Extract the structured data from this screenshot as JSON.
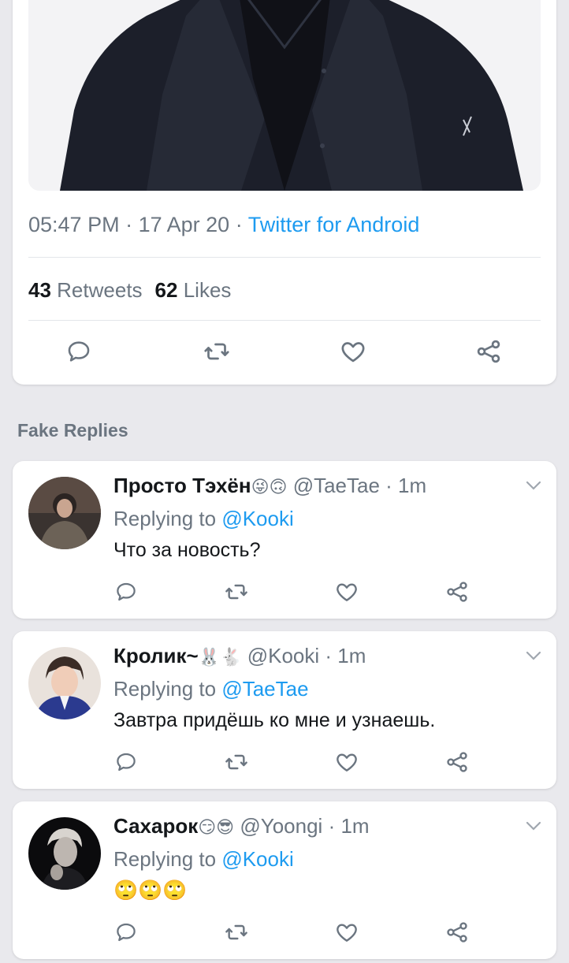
{
  "tweet": {
    "time": "05:47 PM",
    "date": "17 Apr 20",
    "sep": "·",
    "source": "Twitter for Android",
    "retweets_count": "43",
    "retweets_label": "Retweets",
    "likes_count": "62",
    "likes_label": "Likes",
    "actions": [
      "reply-icon",
      "retweet-icon",
      "like-icon",
      "share-icon"
    ]
  },
  "section": {
    "title": "Fake Replies"
  },
  "replies": [
    {
      "name": "Просто Тэхён",
      "emoji": "😜🙃",
      "handle": "@TaeTae",
      "time": "· 1m",
      "replying_label": "Replying to",
      "replying_to": "@Kooki",
      "text": "Что за новость?"
    },
    {
      "name": "Кролик~",
      "emoji": "🐰🐇",
      "handle": "@Kooki",
      "time": "· 1m",
      "replying_label": "Replying to",
      "replying_to": "@TaeTae",
      "text": "Завтра придёшь ко мне и узнаешь."
    },
    {
      "name": "Сахарок",
      "emoji": "😏😎",
      "handle": "@Yoongi",
      "time": "· 1m",
      "replying_label": "Replying to",
      "replying_to": "@Kooki",
      "text": "🙄🙄🙄"
    }
  ],
  "colors": {
    "accent": "#1d9bf0",
    "muted": "#6b7580",
    "background": "#e9e9ed"
  }
}
